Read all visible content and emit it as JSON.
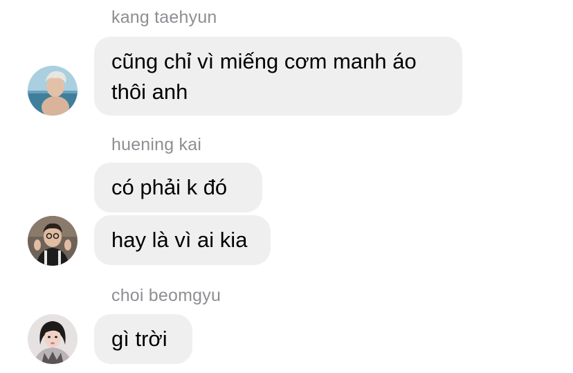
{
  "messages": {
    "group1": {
      "sender": "kang taehyun",
      "bubbles": [
        "cũng chỉ vì miếng cơm manh áo thôi anh"
      ]
    },
    "group2": {
      "sender": "huening kai",
      "bubbles": [
        "có phải k đó",
        "hay là vì ai kia"
      ]
    },
    "group3": {
      "sender": "choi beomgyu",
      "bubbles": [
        "gì trời"
      ]
    }
  },
  "colors": {
    "bubble": "#efefef",
    "sender_text": "#8e8e93",
    "message_text": "#000000",
    "background": "#ffffff"
  }
}
